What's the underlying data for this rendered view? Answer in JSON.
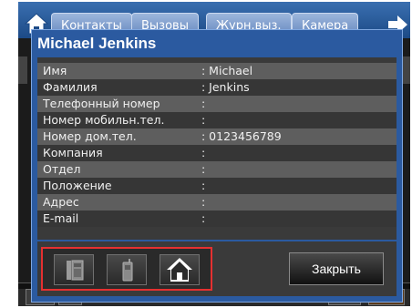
{
  "tabs": [
    {
      "label": "Контакты"
    },
    {
      "label": "Вызовы"
    },
    {
      "label": "Журн.выз."
    },
    {
      "label": "Камера"
    }
  ],
  "dialog": {
    "title": "Michael Jenkins",
    "fields": [
      {
        "label": "Имя",
        "value": ": Michael"
      },
      {
        "label": "Фамилия",
        "value": ": Jenkins"
      },
      {
        "label": "Телефонный номер",
        "value": ":"
      },
      {
        "label": "Номер мобильн.тел.",
        "value": ":"
      },
      {
        "label": "Номер дом.тел.",
        "value": ": 0123456789"
      },
      {
        "label": "Компания",
        "value": ":"
      },
      {
        "label": "Отдел",
        "value": ":"
      },
      {
        "label": "Положение",
        "value": ":"
      },
      {
        "label": "Адрес",
        "value": ":"
      },
      {
        "label": "E-mail",
        "value": ":"
      }
    ],
    "icons": [
      "office-phone-icon",
      "mobile-phone-icon",
      "home-icon"
    ],
    "close_label": "Закрыть"
  },
  "colors": {
    "dialog_bg": "#2b5aa0",
    "highlight": "#e53030"
  }
}
